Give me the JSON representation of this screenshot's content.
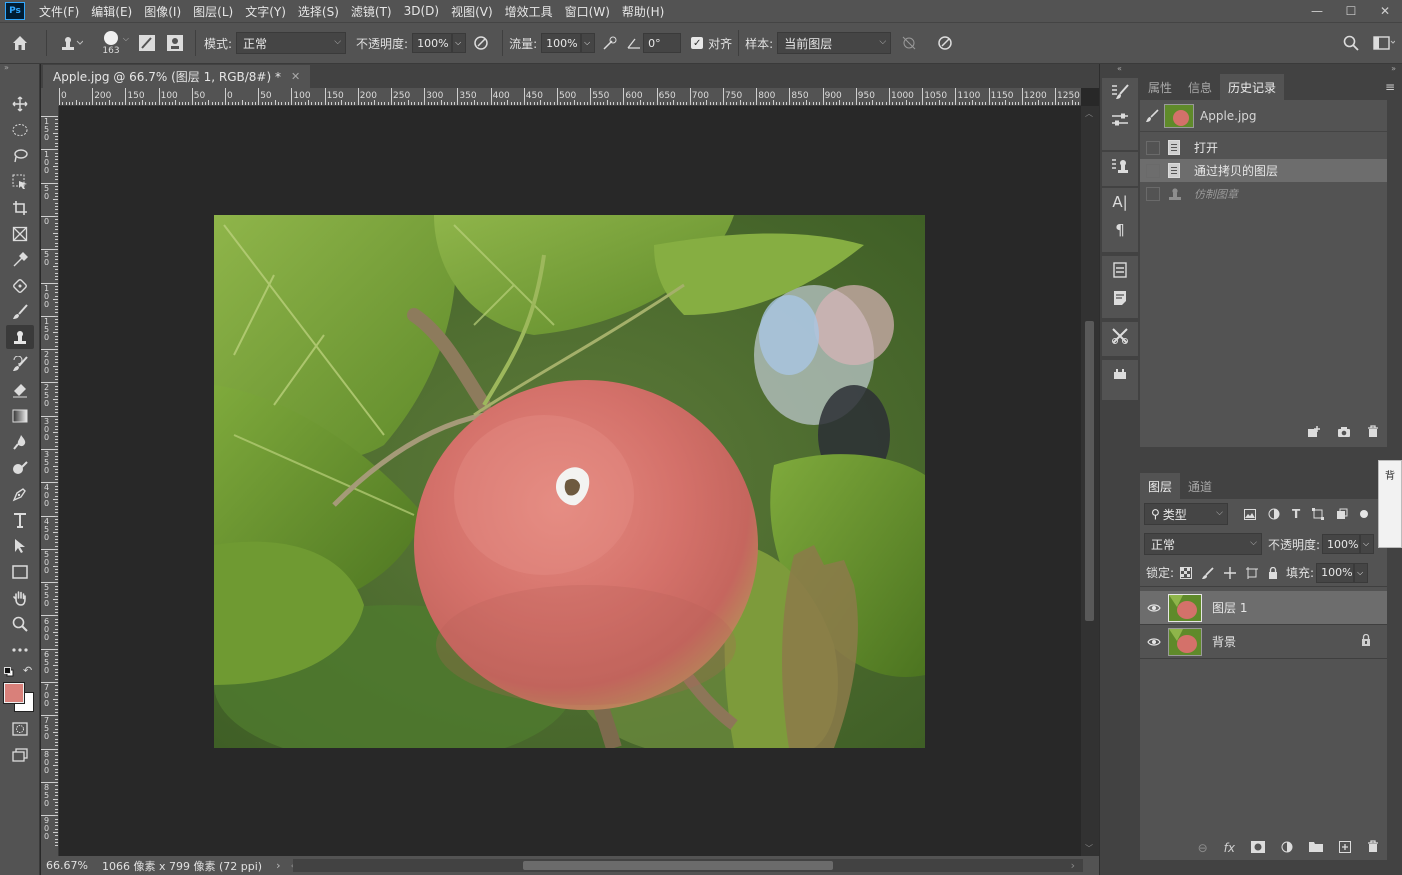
{
  "app": {
    "logo": "Ps"
  },
  "menu": [
    "文件(F)",
    "编辑(E)",
    "图像(I)",
    "图层(L)",
    "文字(Y)",
    "选择(S)",
    "滤镜(T)",
    "3D(D)",
    "视图(V)",
    "增效工具",
    "窗口(W)",
    "帮助(H)"
  ],
  "window_buttons": {
    "minimize": "—",
    "maximize": "☐",
    "close": "✕"
  },
  "options": {
    "brush_size": "163",
    "mode_label": "模式:",
    "mode_value": "正常",
    "opacity_label": "不透明度:",
    "opacity_value": "100%",
    "flow_label": "流量:",
    "flow_value": "100%",
    "angle_value": "0°",
    "align_label": "对齐",
    "sample_label": "样本:",
    "sample_value": "当前图层"
  },
  "document": {
    "tab_title": "Apple.jpg @ 66.7% (图层 1, RGB/8#) *",
    "zoom": "66.67%",
    "info": "1066 像素 x 799 像素 (72 ppi)"
  },
  "ruler": {
    "top_labels": [
      "0",
      "200",
      "150",
      "100",
      "50",
      "0",
      "50",
      "100",
      "150",
      "200",
      "250",
      "300",
      "350",
      "400",
      "450",
      "500",
      "550",
      "600",
      "650",
      "700",
      "750",
      "800",
      "850",
      "900",
      "950",
      "1000",
      "1050",
      "1100",
      "1150",
      "1200",
      "1250"
    ],
    "left_labels": [
      "1 5 0",
      "1 0 0",
      "5 0",
      "0",
      "5 0",
      "1 0 0",
      "1 5 0",
      "2 0 0",
      "2 5 0",
      "3 0 0",
      "3 5 0",
      "4 0 0",
      "4 5 0",
      "5 0 0",
      "5 5 0",
      "6 0 0",
      "6 5 0",
      "7 0 0",
      "7 5 0",
      "8 0 0",
      "8 5 0",
      "9 0 0"
    ]
  },
  "history_panel": {
    "tabs": [
      "属性",
      "信息",
      "历史记录"
    ],
    "active_tab": "历史记录",
    "snapshot": "Apple.jpg",
    "items": [
      "打开",
      "通过拷贝的图层",
      "仿制图章"
    ]
  },
  "layers_panel": {
    "tabs": [
      "图层",
      "通道"
    ],
    "active_tab": "图层",
    "filter_label": "类型",
    "blend_mode": "正常",
    "opacity_label": "不透明度:",
    "opacity_value": "100%",
    "lock_label": "锁定:",
    "fill_label": "填充:",
    "fill_value": "100%",
    "layers": [
      {
        "name": "图层 1",
        "selected": true
      },
      {
        "name": "背景",
        "locked": true
      }
    ],
    "footer_fx": "fx"
  },
  "side_popout": "背",
  "colors": {
    "foreground": "#d9807a",
    "background": "#ffffff",
    "ui_dark": "#282828",
    "ui_mid": "#535353",
    "selection": "#6d6d6d"
  }
}
